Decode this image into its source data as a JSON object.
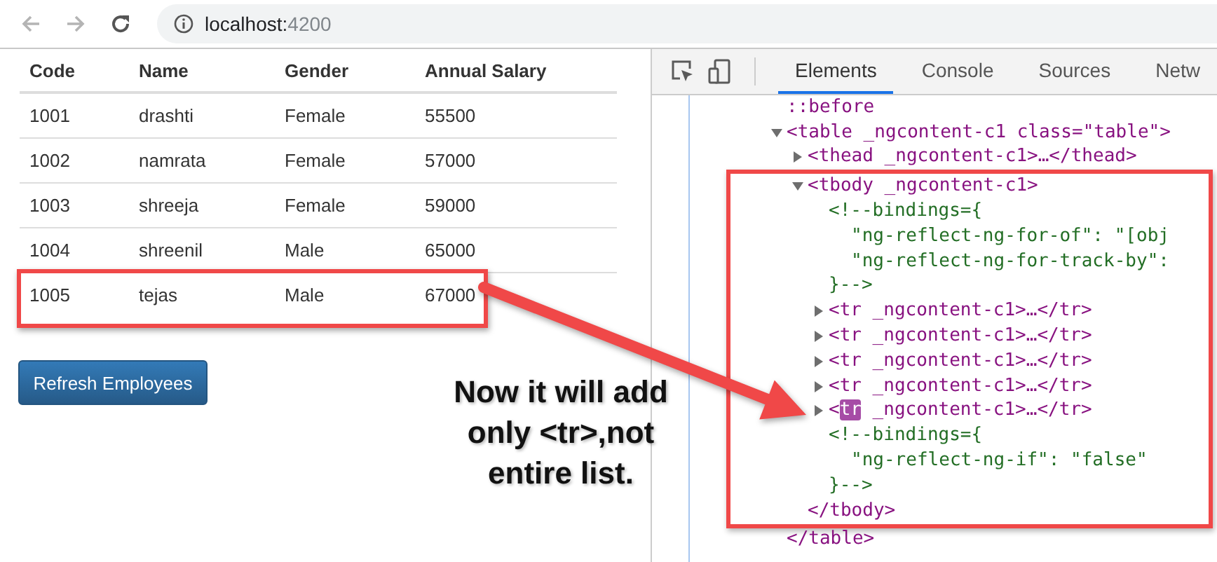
{
  "address": {
    "host": "localhost:",
    "port": "4200"
  },
  "table": {
    "columns": [
      "Code",
      "Name",
      "Gender",
      "Annual Salary"
    ],
    "rows": [
      {
        "cells": [
          "1001",
          "drashti",
          "Female",
          "55500"
        ],
        "outlined": false
      },
      {
        "cells": [
          "1002",
          "namrata",
          "Female",
          "57000"
        ],
        "outlined": false
      },
      {
        "cells": [
          "1003",
          "shreeja",
          "Female",
          "59000"
        ],
        "outlined": false
      },
      {
        "cells": [
          "1004",
          "shreenil",
          "Male",
          "65000"
        ],
        "outlined": false
      },
      {
        "cells": [
          "1005",
          "tejas",
          "Male",
          "67000"
        ],
        "outlined": true
      }
    ]
  },
  "refresh_button": "Refresh Employees",
  "annotation": {
    "lines": [
      "Now it will add",
      "only <tr>,not",
      "entire list."
    ]
  },
  "devtools": {
    "tabs": [
      {
        "label": "Elements",
        "selected": true
      },
      {
        "label": "Console",
        "selected": false
      },
      {
        "label": "Sources",
        "selected": false
      },
      {
        "label": "Netw",
        "selected": false
      }
    ],
    "tree": [
      {
        "kind": "pseudo",
        "text": "::before"
      },
      {
        "kind": "tag",
        "text": "<table _ngcontent-c1 class=\"table\">",
        "expanded": true,
        "outlined": false,
        "close": "</table>",
        "children": [
          {
            "kind": "tag",
            "text": "<thead _ngcontent-c1>…</thead>",
            "expanded": false,
            "outlined": false
          },
          {
            "kind": "tag",
            "text": "<tbody _ngcontent-c1>",
            "expanded": true,
            "outlined": true,
            "close": "</tbody>",
            "children": [
              {
                "kind": "comment",
                "lines": [
                  "<!--bindings={",
                  "\"ng-reflect-ng-for-of\": \"[obj",
                  "\"ng-reflect-ng-for-track-by\":",
                  "}-->"
                ]
              },
              {
                "kind": "tag",
                "text": "<tr _ngcontent-c1>…</tr>",
                "expanded": false,
                "outlined": false
              },
              {
                "kind": "tag",
                "text": "<tr _ngcontent-c1>…</tr>",
                "expanded": false,
                "outlined": false
              },
              {
                "kind": "tag",
                "text": "<tr _ngcontent-c1>…</tr>",
                "expanded": false,
                "outlined": false
              },
              {
                "kind": "tag",
                "text": "<tr _ngcontent-c1>…</tr>",
                "expanded": false,
                "outlined": false
              },
              {
                "kind": "tag",
                "segments": [
                  {
                    "text": "<",
                    "highlighted": false
                  },
                  {
                    "text": "tr",
                    "highlighted": true
                  },
                  {
                    "text": " _ngcontent-c1>…</tr>",
                    "highlighted": false
                  }
                ],
                "expanded": false,
                "outlined": false
              },
              {
                "kind": "comment",
                "lines": [
                  "<!--bindings={",
                  "\"ng-reflect-ng-if\": \"false\"",
                  "}-->"
                ]
              }
            ]
          }
        ]
      }
    ]
  }
}
